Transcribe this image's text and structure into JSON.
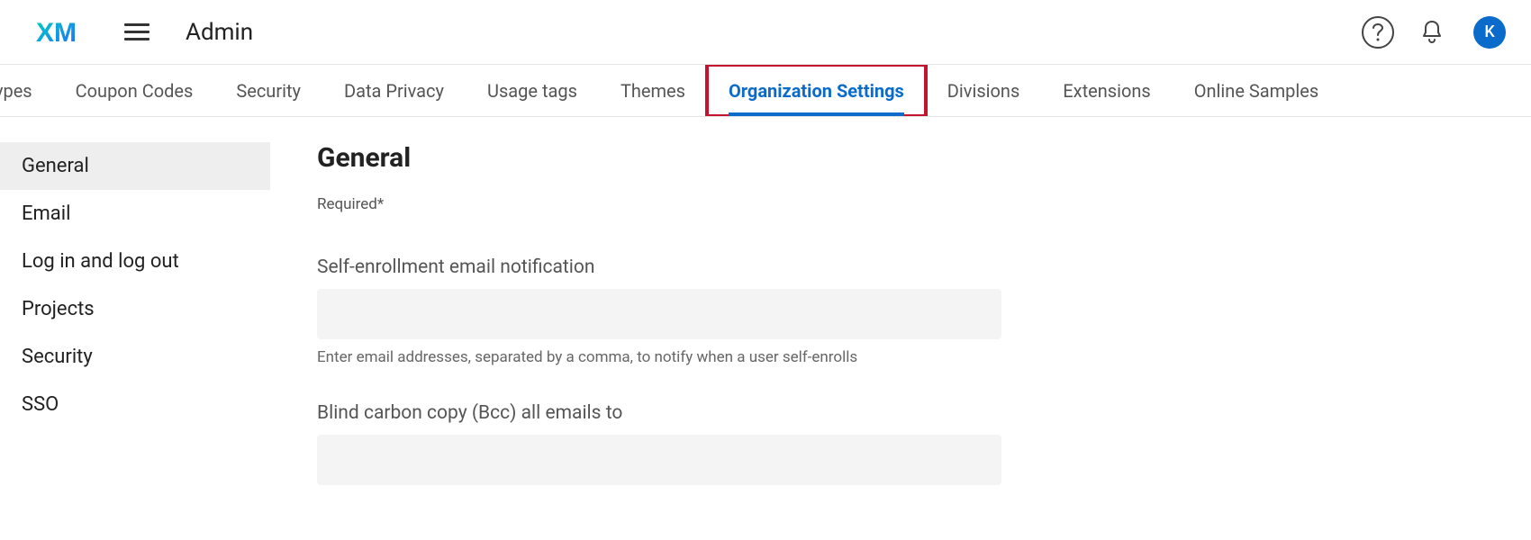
{
  "header": {
    "app_title": "Admin",
    "avatar_letter": "K"
  },
  "tabs": [
    {
      "label": "ypes",
      "active": false,
      "highlighted": false
    },
    {
      "label": "Coupon Codes",
      "active": false,
      "highlighted": false
    },
    {
      "label": "Security",
      "active": false,
      "highlighted": false
    },
    {
      "label": "Data Privacy",
      "active": false,
      "highlighted": false
    },
    {
      "label": "Usage tags",
      "active": false,
      "highlighted": false
    },
    {
      "label": "Themes",
      "active": false,
      "highlighted": false
    },
    {
      "label": "Organization Settings",
      "active": true,
      "highlighted": true
    },
    {
      "label": "Divisions",
      "active": false,
      "highlighted": false
    },
    {
      "label": "Extensions",
      "active": false,
      "highlighted": false
    },
    {
      "label": "Online Samples",
      "active": false,
      "highlighted": false
    }
  ],
  "sidebar": {
    "items": [
      {
        "label": "General",
        "selected": true
      },
      {
        "label": "Email",
        "selected": false
      },
      {
        "label": "Log in and log out",
        "selected": false
      },
      {
        "label": "Projects",
        "selected": false
      },
      {
        "label": "Security",
        "selected": false
      },
      {
        "label": "SSO",
        "selected": false
      }
    ]
  },
  "page": {
    "title": "General",
    "required_hint": "Required*",
    "fields": [
      {
        "label": "Self-enrollment email notification",
        "value": "",
        "help": "Enter email addresses, separated by a comma, to notify when a user self-enrolls"
      },
      {
        "label": "Blind carbon copy (Bcc) all emails to",
        "value": "",
        "help": ""
      }
    ]
  }
}
